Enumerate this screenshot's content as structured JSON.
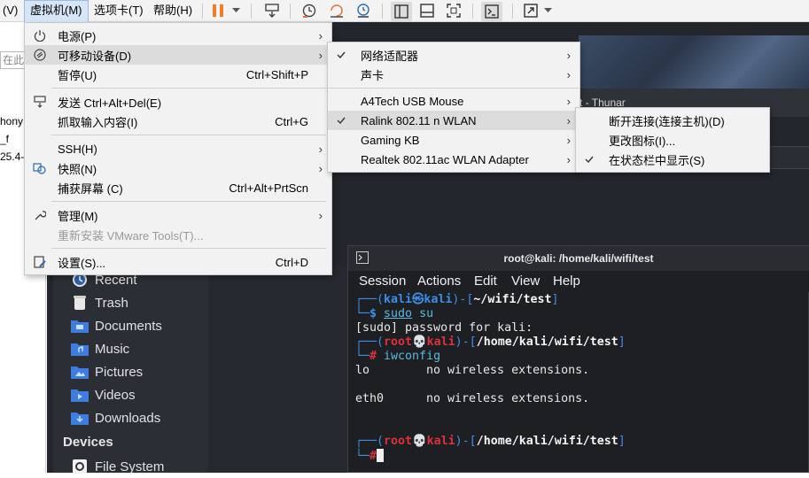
{
  "menubar": {
    "partial_left": "(V)",
    "items": [
      "虚拟机(M)",
      "选项卡(T)",
      "帮助(H)"
    ]
  },
  "host": {
    "search_placeholder": "在此处搜索",
    "lines": [
      "hony",
      "_f",
      "25.4-"
    ]
  },
  "vm_menu": {
    "items": [
      {
        "label": "电源(P)",
        "icon": "power-icon",
        "submenu": true
      },
      {
        "label": "可移动设备(D)",
        "icon": "removable-device-icon",
        "submenu": true,
        "highlighted": true
      },
      {
        "label": "暂停(U)",
        "shortcut": "Ctrl+Shift+P"
      },
      {
        "label": "发送 Ctrl+Alt+Del(E)",
        "icon": "keyboard-icon"
      },
      {
        "label": "抓取输入内容(I)",
        "shortcut": "Ctrl+G"
      },
      {
        "label": "SSH(H)",
        "submenu": true
      },
      {
        "label": "快照(N)",
        "icon": "snapshot-icon",
        "submenu": true
      },
      {
        "label": "捕获屏幕 (C)",
        "shortcut": "Ctrl+Alt+PrtScn"
      },
      {
        "label": "管理(M)",
        "icon": "wrench-icon",
        "submenu": true
      },
      {
        "label": "重新安装 VMware Tools(T)...",
        "disabled": true
      },
      {
        "label": "设置(S)...",
        "icon": "settings-icon",
        "shortcut": "Ctrl+D"
      }
    ]
  },
  "devices_menu": {
    "items": [
      {
        "label": "网络适配器",
        "checked": true,
        "submenu": true
      },
      {
        "label": "声卡",
        "submenu": true
      },
      {
        "label": "A4Tech USB Mouse",
        "submenu": true
      },
      {
        "label": "Ralink 802.11 n WLAN",
        "checked": true,
        "submenu": true,
        "highlighted": true
      },
      {
        "label": "Gaming KB",
        "submenu": true
      },
      {
        "label": "Realtek 802.11ac WLAN Adapter",
        "submenu": true
      }
    ]
  },
  "wlan_menu": {
    "items": [
      {
        "label": "断开连接(连接主机)(D)"
      },
      {
        "label": "更改图标(I)..."
      },
      {
        "label": "在状态栏中显示(S)",
        "checked": true
      }
    ]
  },
  "thunar": {
    "title_partial": "st - Thunar",
    "sidebar": [
      {
        "label": "Recent",
        "icon": "recent-icon"
      },
      {
        "label": "Trash",
        "icon": "trash-icon"
      },
      {
        "label": "Documents",
        "icon": "documents-folder-icon"
      },
      {
        "label": "Music",
        "icon": "music-folder-icon"
      },
      {
        "label": "Pictures",
        "icon": "pictures-folder-icon"
      },
      {
        "label": "Videos",
        "icon": "videos-folder-icon"
      },
      {
        "label": "Downloads",
        "icon": "downloads-folder-icon"
      }
    ],
    "devices_heading": "Devices",
    "devices": [
      {
        "label": "File System",
        "icon": "filesystem-icon"
      }
    ]
  },
  "terminal": {
    "title": "root@kali: /home/kali/wifi/test",
    "menu": [
      "Session",
      "Actions",
      "Edit",
      "View",
      "Help"
    ],
    "p1_user": "kali",
    "p1_at": "㉿",
    "p1_host": "kali",
    "p1_path": "~/wifi/test",
    "p1_cmd_sudo": "sudo",
    "p1_cmd_rest": " su",
    "sudo_prompt": "[sudo] password for kali:",
    "p2_user": "root",
    "p2_at": "💀",
    "p2_host": "kali",
    "p2_path": "/home/kali/wifi/test",
    "p2_cmd": "iwconfig",
    "out_lo_if": "lo",
    "out_lo_msg": "no wireless extensions.",
    "out_eth_if": "eth0",
    "out_eth_msg": "no wireless extensions.",
    "p3_user": "root",
    "p3_at": "💀",
    "p3_host": "kali",
    "p3_path": "/home/kali/wifi/test"
  },
  "colors": {
    "prompt_blue": "#3b8eea",
    "root_red": "#e0303a",
    "pause_orange": "#f07c2c",
    "menu_highlight": "#dcdcdc"
  }
}
